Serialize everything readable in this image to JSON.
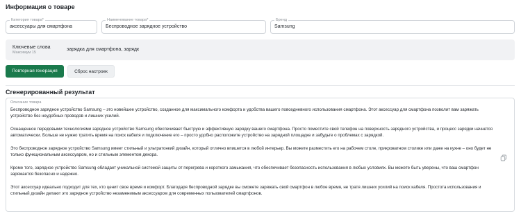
{
  "product_info": {
    "title": "Информация о товаре",
    "category": {
      "label": "Категория товара*",
      "value": "аксессуары для смартфона"
    },
    "name": {
      "label": "Наименование товара*",
      "value": "Беспроводное зарядное устройство"
    },
    "brand": {
      "label": "Бренд",
      "value": "Samsung"
    },
    "keywords": {
      "label": "Ключевые слова",
      "sublabel": "Максимум 15",
      "value": "зарядка для смартфона, зарядк"
    }
  },
  "actions": {
    "regenerate_label": "Повторная генерация",
    "reset_label": "Сброс настроек"
  },
  "result": {
    "title": "Сгенерированный результат",
    "field_label": "Описание товара",
    "paragraphs": [
      "Беспроводное зарядное устройство Samsung – это новейшее устройство, созданное для максимального комфорта и удобства вашего повседневного использования смартфона. Этот аксессуар для смартфона позволит вам заряжать устройство без неудобных проводов и лишних усилий.",
      "Оснащенное передовыми технологиями зарядное устройство Samsung обеспечивает быструю и эффективную зарядку вашего смартфона. Просто поместите свой телефон на поверхность зарядного устройства, и процесс зарядки начнется автоматически. Больше не нужно тратить время на поиск кабеля и подключение его – просто удобно расположите устройство на зарядной площадке и забудьте о проблемах с зарядкой.",
      "Это беспроводное зарядное устройство Samsung имеет стильный и ультратонкий дизайн, который отлично впишется в любой интерьер. Вы можете разместить его на рабочем столе, прикроватном столике или даже на кухне – оно будет не только функциональным аксессуаром, но и стильным элементом декора.",
      "Кроме того, зарядное устройство Samsung обладает уникальной системой защиты от перегрева и короткого замыкания, что обеспечивает безопасность использования в любых условиях. Вы можете быть уверены, что ваш смартфон заряжается безопасно и надежно.",
      "Этот аксессуар идеально подходит для тех, кто ценит свое время и комфорт. Благодаря беспроводной зарядке вы сможете заряжать свой смартфон в любое время, не тратя лишних усилий на поиск кабеля. Простота использования и стильный дизайн делают это зарядное устройство незаменимым аксессуаром для современных пользователей смартфонов."
    ]
  },
  "colors": {
    "primary_button": "#1a7a4c",
    "secondary_button": "#eef0f2",
    "keywords_background": "#f1f2f4"
  },
  "icons": {
    "copy": "copy-icon"
  }
}
